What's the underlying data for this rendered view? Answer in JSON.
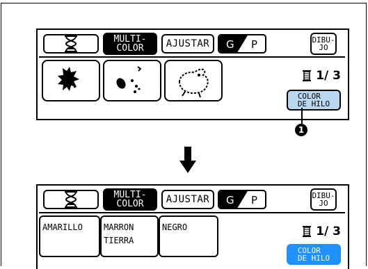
{
  "topbar": {
    "multicolor_label": "MULTI-\nCOLOR",
    "ajustar_label": "AJUSTAR",
    "g_label": "G",
    "p_label": "P",
    "dibujo_label": "DIBU-\nJO"
  },
  "panel1": {
    "counter": "1/ 3",
    "color_btn_label": "COLOR\nDE HILO"
  },
  "panel2": {
    "threads": [
      "AMARILLO",
      "MARRON\nTIERRA",
      "NEGRO"
    ],
    "counter": "1/ 3",
    "color_btn_label": "COLOR\nDE HILO"
  },
  "callout": "1",
  "colors": {
    "light_button": "#b9d8f0",
    "active_button": "#1e90ff"
  }
}
